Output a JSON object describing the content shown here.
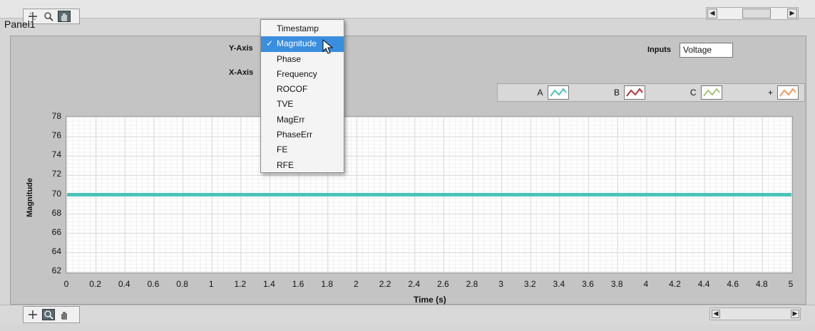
{
  "panel": {
    "title": "Panel1"
  },
  "controls": {
    "y_axis_label": "Y-Axis",
    "x_axis_label": "X-Axis",
    "inputs_label": "Inputs",
    "inputs_value": "Voltage"
  },
  "dropdown": {
    "selected": "Magnitude",
    "check_mark": "✓",
    "items": [
      "Timestamp",
      "Magnitude",
      "Phase",
      "Frequency",
      "ROCOF",
      "TVE",
      "MagErr",
      "PhaseErr",
      "FE",
      "RFE"
    ]
  },
  "legend": {
    "items": [
      {
        "label": "A",
        "color": "#4cc3b7"
      },
      {
        "label": "B",
        "color": "#b3353a"
      },
      {
        "label": "C",
        "color": "#a9c47a"
      },
      {
        "label": "+",
        "color": "#f29b5e"
      }
    ]
  },
  "toolbar_icons": [
    "crosshair-icon",
    "zoom-icon",
    "pan-hand-icon"
  ],
  "chart_data": {
    "type": "line",
    "xlabel": "Time (s)",
    "ylabel": "Magnitude",
    "xlim": [
      0,
      5
    ],
    "ylim": [
      62,
      78
    ],
    "x_ticks": [
      "0",
      "0.2",
      "0.4",
      "0.6",
      "0.8",
      "1",
      "1.2",
      "1.4",
      "1.6",
      "1.8",
      "2",
      "2.2",
      "2.4",
      "2.6",
      "2.8",
      "3",
      "3.2",
      "3.4",
      "3.6",
      "3.8",
      "4",
      "4.2",
      "4.4",
      "4.6",
      "4.8",
      "5"
    ],
    "y_ticks": [
      "62",
      "64",
      "66",
      "68",
      "70",
      "72",
      "74",
      "76",
      "78"
    ],
    "grid": true,
    "series": [
      {
        "name": "A",
        "color": "#4cc3b7",
        "x": [
          0,
          5
        ],
        "y": [
          70,
          70
        ]
      }
    ]
  }
}
